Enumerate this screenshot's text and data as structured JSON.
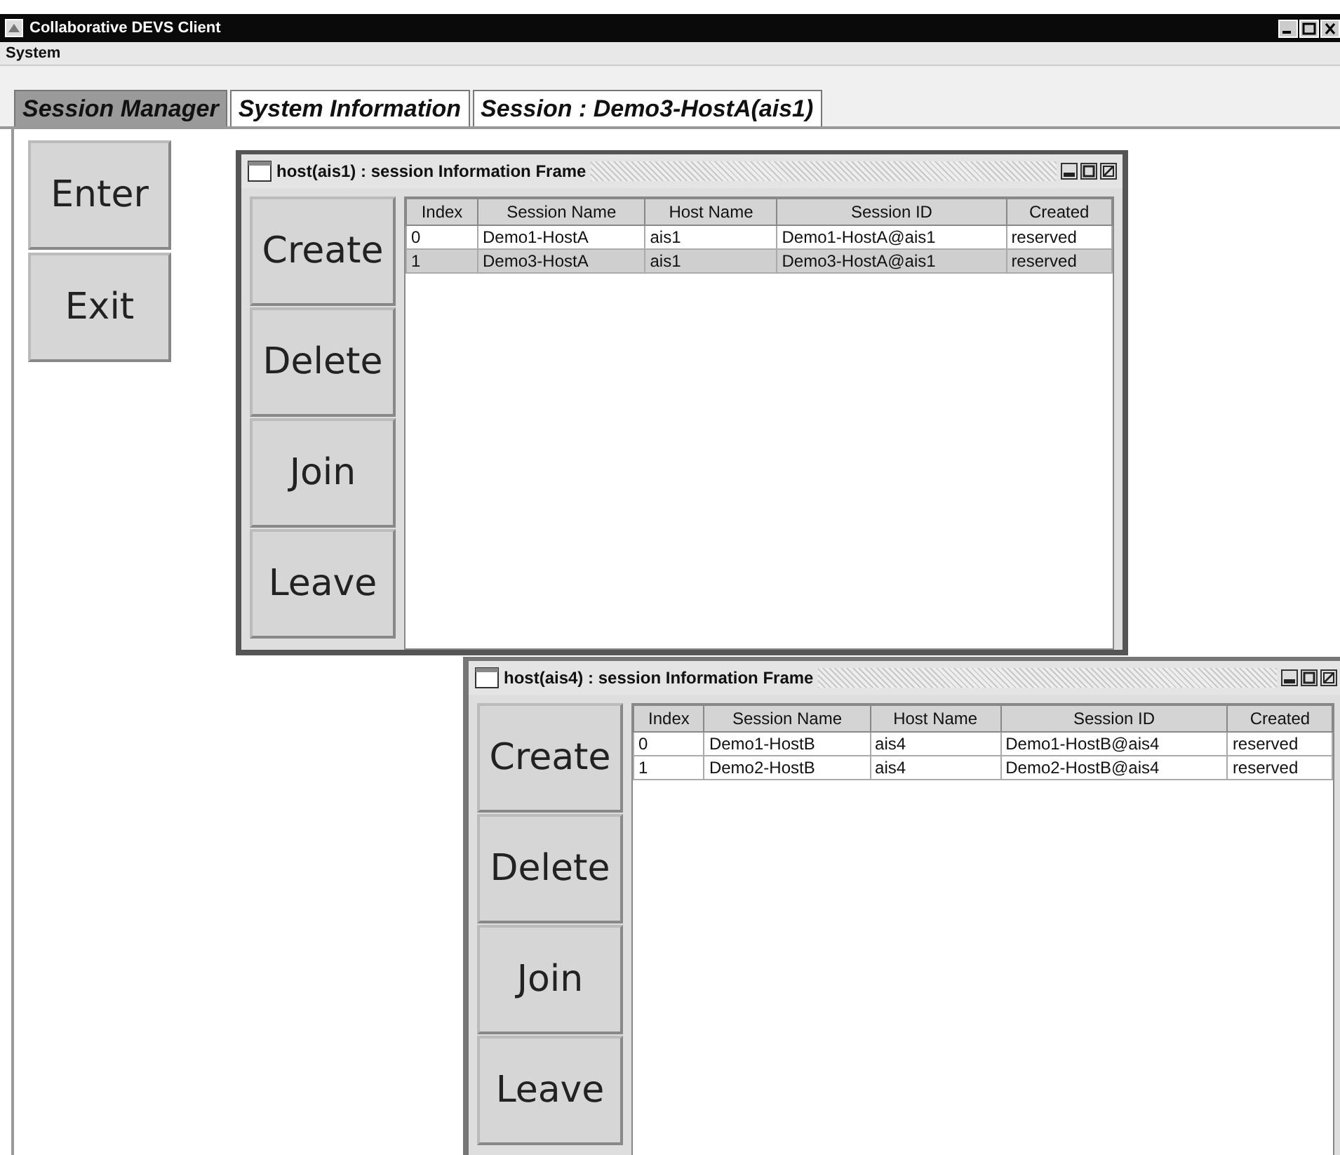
{
  "window": {
    "title": "Collaborative DEVS Client"
  },
  "menu": [
    "System"
  ],
  "tabs": [
    {
      "label": "Session Manager",
      "selected": true
    },
    {
      "label": "System Information",
      "selected": false
    },
    {
      "label": "Session : Demo3-HostA(ais1)",
      "selected": false
    }
  ],
  "side_buttons": [
    "Enter",
    "Exit"
  ],
  "frames": [
    {
      "title": "host(ais1) : session Information Frame",
      "buttons": [
        "Create",
        "Delete",
        "Join",
        "Leave"
      ],
      "table": {
        "columns": [
          "Index",
          "Session Name",
          "Host Name",
          "Session ID",
          "Created"
        ],
        "rows": [
          {
            "cells": [
              "0",
              "Demo1-HostA",
              "ais1",
              "Demo1-HostA@ais1",
              "reserved"
            ],
            "selected": false
          },
          {
            "cells": [
              "1",
              "Demo3-HostA",
              "ais1",
              "Demo3-HostA@ais1",
              "reserved"
            ],
            "selected": true
          }
        ]
      }
    },
    {
      "title": "host(ais4) : session Information Frame",
      "buttons": [
        "Create",
        "Delete",
        "Join",
        "Leave"
      ],
      "table": {
        "columns": [
          "Index",
          "Session Name",
          "Host Name",
          "Session ID",
          "Created"
        ],
        "rows": [
          {
            "cells": [
              "0",
              "Demo1-HostB",
              "ais4",
              "Demo1-HostB@ais4",
              "reserved"
            ],
            "selected": false
          },
          {
            "cells": [
              "1",
              "Demo2-HostB",
              "ais4",
              "Demo2-HostB@ais4",
              "reserved"
            ],
            "selected": false
          }
        ]
      }
    }
  ]
}
